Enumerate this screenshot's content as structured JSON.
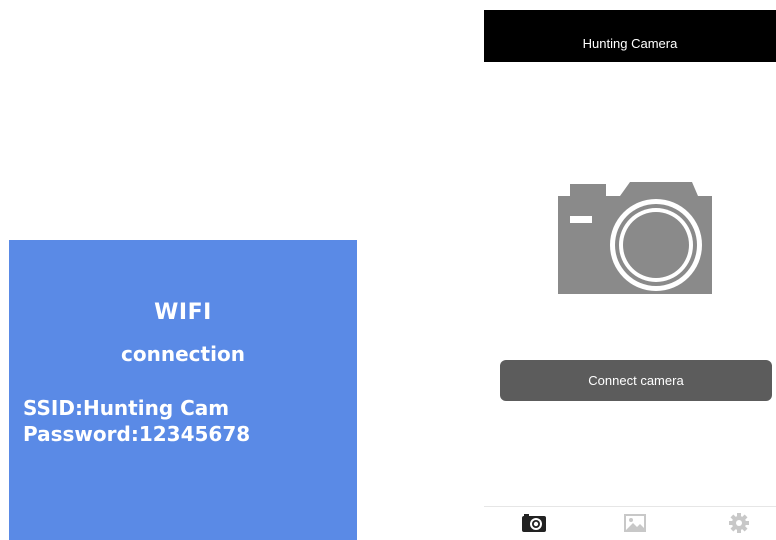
{
  "wifi_panel": {
    "title": "WIFI",
    "subtitle": "connection",
    "ssid": "SSID:Hunting Cam",
    "password": "Password:12345678",
    "bg_color": "#5a8ae6"
  },
  "app": {
    "title": "Hunting Camera",
    "main_icon": "camera-icon",
    "connect_label": "Connect camera",
    "colors": {
      "header": "#000000",
      "button": "#5c5c5c",
      "icon_gray": "#8a8a8a",
      "tab_inactive": "#c8c8c8"
    },
    "tabs": [
      {
        "icon": "camera-tab-icon",
        "active": true
      },
      {
        "icon": "image-icon",
        "active": false
      },
      {
        "icon": "gear-icon",
        "active": false
      }
    ]
  }
}
